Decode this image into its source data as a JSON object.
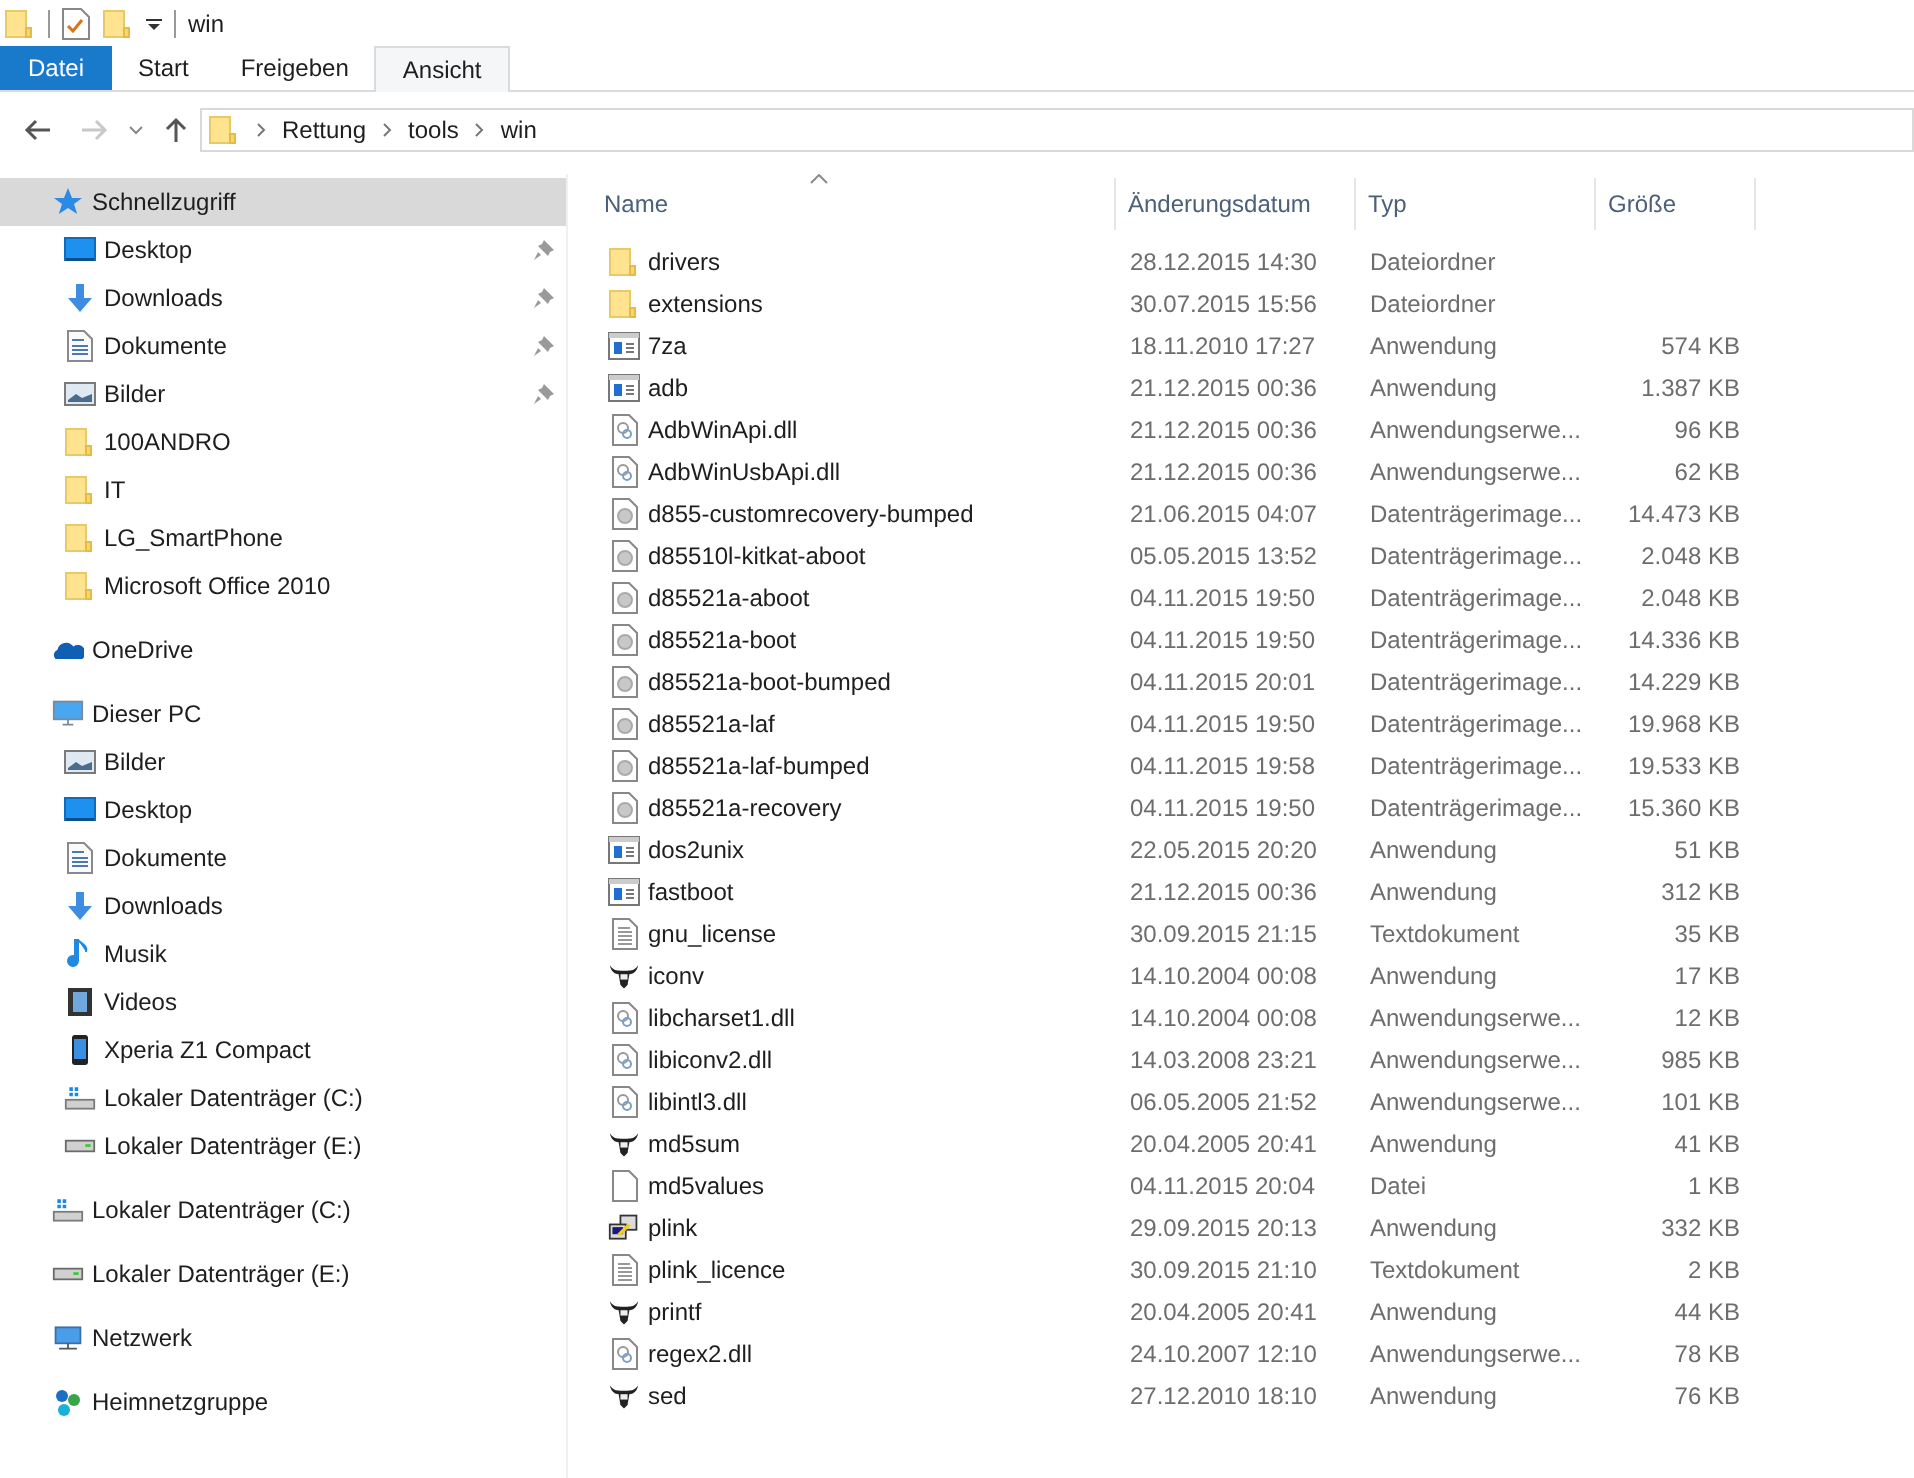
{
  "window": {
    "title": "win"
  },
  "ribbon": {
    "file_tab": "Datei",
    "tabs": [
      {
        "label": "Start",
        "selected": false
      },
      {
        "label": "Freigeben",
        "selected": false
      },
      {
        "label": "Ansicht",
        "selected": true
      }
    ]
  },
  "address_bar": {
    "path": [
      "Rettung",
      "tools",
      "win"
    ]
  },
  "sidebar": {
    "items": [
      {
        "label": "Schnellzugriff",
        "kind": "star",
        "selected": true,
        "children": [
          {
            "label": "Desktop",
            "kind": "desktop",
            "pinned": true
          },
          {
            "label": "Downloads",
            "kind": "download",
            "pinned": true
          },
          {
            "label": "Dokumente",
            "kind": "document",
            "pinned": true
          },
          {
            "label": "Bilder",
            "kind": "picture",
            "pinned": true
          },
          {
            "label": "100ANDRO",
            "kind": "folder",
            "pinned": false
          },
          {
            "label": "IT",
            "kind": "folder",
            "pinned": false
          },
          {
            "label": "LG_SmartPhone",
            "kind": "folder",
            "pinned": false
          },
          {
            "label": "Microsoft Office 2010",
            "kind": "folder",
            "pinned": false
          }
        ]
      },
      {
        "label": "OneDrive",
        "kind": "cloud",
        "selected": false
      },
      {
        "label": "Dieser PC",
        "kind": "pc",
        "selected": false,
        "children": [
          {
            "label": "Bilder",
            "kind": "picture",
            "pinned": false
          },
          {
            "label": "Desktop",
            "kind": "desktop",
            "pinned": false
          },
          {
            "label": "Dokumente",
            "kind": "document",
            "pinned": false
          },
          {
            "label": "Downloads",
            "kind": "download",
            "pinned": false
          },
          {
            "label": "Musik",
            "kind": "music",
            "pinned": false
          },
          {
            "label": "Videos",
            "kind": "video",
            "pinned": false
          },
          {
            "label": "Xperia Z1 Compact",
            "kind": "phone",
            "pinned": false
          },
          {
            "label": "Lokaler Datenträger (C:)",
            "kind": "windrive",
            "pinned": false
          },
          {
            "label": "Lokaler Datenträger (E:)",
            "kind": "drive",
            "pinned": false
          }
        ]
      },
      {
        "label": "Lokaler Datenträger (C:)",
        "kind": "windrive",
        "selected": false
      },
      {
        "label": "Lokaler Datenträger (E:)",
        "kind": "drive",
        "selected": false
      },
      {
        "label": "Netzwerk",
        "kind": "network",
        "selected": false
      },
      {
        "label": "Heimnetzgruppe",
        "kind": "homegroup",
        "selected": false
      }
    ]
  },
  "file_list": {
    "columns": [
      "Name",
      "Änderungsdatum",
      "Typ",
      "Größe"
    ],
    "rows": [
      {
        "kind": "folder",
        "name": "drivers",
        "date": "28.12.2015 14:30",
        "type": "Dateiordner",
        "size": ""
      },
      {
        "kind": "folder",
        "name": "extensions",
        "date": "30.07.2015 15:56",
        "type": "Dateiordner",
        "size": ""
      },
      {
        "kind": "app",
        "name": "7za",
        "date": "18.11.2010 17:27",
        "type": "Anwendung",
        "size": "574 KB"
      },
      {
        "kind": "app",
        "name": "adb",
        "date": "21.12.2015 00:36",
        "type": "Anwendung",
        "size": "1.387 KB"
      },
      {
        "kind": "dll",
        "name": "AdbWinApi.dll",
        "date": "21.12.2015 00:36",
        "type": "Anwendungserwe...",
        "size": "96 KB"
      },
      {
        "kind": "dll",
        "name": "AdbWinUsbApi.dll",
        "date": "21.12.2015 00:36",
        "type": "Anwendungserwe...",
        "size": "62 KB"
      },
      {
        "kind": "image",
        "name": "d855-customrecovery-bumped",
        "date": "21.06.2015 04:07",
        "type": "Datenträgerimage...",
        "size": "14.473 KB"
      },
      {
        "kind": "image",
        "name": "d85510l-kitkat-aboot",
        "date": "05.05.2015 13:52",
        "type": "Datenträgerimage...",
        "size": "2.048 KB"
      },
      {
        "kind": "image",
        "name": "d85521a-aboot",
        "date": "04.11.2015 19:50",
        "type": "Datenträgerimage...",
        "size": "2.048 KB"
      },
      {
        "kind": "image",
        "name": "d85521a-boot",
        "date": "04.11.2015 19:50",
        "type": "Datenträgerimage...",
        "size": "14.336 KB"
      },
      {
        "kind": "image",
        "name": "d85521a-boot-bumped",
        "date": "04.11.2015 20:01",
        "type": "Datenträgerimage...",
        "size": "14.229 KB"
      },
      {
        "kind": "image",
        "name": "d85521a-laf",
        "date": "04.11.2015 19:50",
        "type": "Datenträgerimage...",
        "size": "19.968 KB"
      },
      {
        "kind": "image",
        "name": "d85521a-laf-bumped",
        "date": "04.11.2015 19:58",
        "type": "Datenträgerimage...",
        "size": "19.533 KB"
      },
      {
        "kind": "image",
        "name": "d85521a-recovery",
        "date": "04.11.2015 19:50",
        "type": "Datenträgerimage...",
        "size": "15.360 KB"
      },
      {
        "kind": "app",
        "name": "dos2unix",
        "date": "22.05.2015 20:20",
        "type": "Anwendung",
        "size": "51 KB"
      },
      {
        "kind": "app",
        "name": "fastboot",
        "date": "21.12.2015 00:36",
        "type": "Anwendung",
        "size": "312 KB"
      },
      {
        "kind": "text",
        "name": "gnu_license",
        "date": "30.09.2015 21:15",
        "type": "Textdokument",
        "size": "35 KB"
      },
      {
        "kind": "gnu",
        "name": "iconv",
        "date": "14.10.2004 00:08",
        "type": "Anwendung",
        "size": "17 KB"
      },
      {
        "kind": "dll",
        "name": "libcharset1.dll",
        "date": "14.10.2004 00:08",
        "type": "Anwendungserwe...",
        "size": "12 KB"
      },
      {
        "kind": "dll",
        "name": "libiconv2.dll",
        "date": "14.03.2008 23:21",
        "type": "Anwendungserwe...",
        "size": "985 KB"
      },
      {
        "kind": "dll",
        "name": "libintl3.dll",
        "date": "06.05.2005 21:52",
        "type": "Anwendungserwe...",
        "size": "101 KB"
      },
      {
        "kind": "gnu",
        "name": "md5sum",
        "date": "20.04.2005 20:41",
        "type": "Anwendung",
        "size": "41 KB"
      },
      {
        "kind": "blank",
        "name": "md5values",
        "date": "04.11.2015 20:04",
        "type": "Datei",
        "size": "1 KB"
      },
      {
        "kind": "putty",
        "name": "plink",
        "date": "29.09.2015 20:13",
        "type": "Anwendung",
        "size": "332 KB"
      },
      {
        "kind": "text",
        "name": "plink_licence",
        "date": "30.09.2015 21:10",
        "type": "Textdokument",
        "size": "2 KB"
      },
      {
        "kind": "gnu",
        "name": "printf",
        "date": "20.04.2005 20:41",
        "type": "Anwendung",
        "size": "44 KB"
      },
      {
        "kind": "dll",
        "name": "regex2.dll",
        "date": "24.10.2007 12:10",
        "type": "Anwendungserwe...",
        "size": "78 KB"
      },
      {
        "kind": "gnu",
        "name": "sed",
        "date": "27.12.2010 18:10",
        "type": "Anwendung",
        "size": "76 KB"
      }
    ]
  }
}
